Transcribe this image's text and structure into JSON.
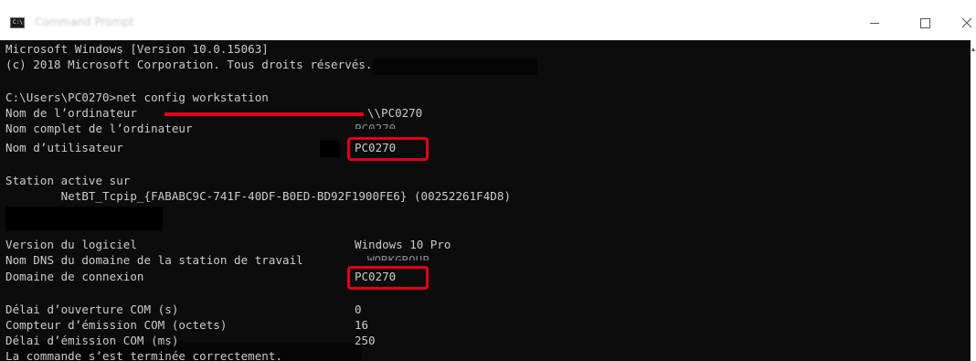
{
  "window": {
    "title": "Command Prompt",
    "minimize_label": "—",
    "maximize_label": "☐",
    "close_label": "✕"
  },
  "console": {
    "header_line1": "Microsoft Windows [Version 10.0.15063]",
    "header_line2": "(c) 2018 Microsoft Corporation. Tous droits réservés.",
    "prompt_line": "C:\\Users\\PC0270>net config workstation",
    "rows": [
      {
        "label": "Nom de l’ordinateur",
        "value": "\\\\PC0270"
      },
      {
        "label": "Nom complet de l’ordinateur",
        "value": "PC0270"
      },
      {
        "label": "Nom d’utilisateur",
        "value": "PC0270"
      }
    ],
    "station_label": "Station active sur",
    "station_value": "        NetBT_Tcpip_{FABABC9C-741F-40DF-B0ED-BD92F1900FE6} (00252261F4D8)",
    "rows2": [
      {
        "label": "Version du logiciel",
        "value": "Windows 10 Pro"
      },
      {
        "label": "Nom DNS du domaine de la station de travail",
        "value": "WORKGROUP"
      },
      {
        "label": "Domaine de connexion",
        "value": "PC0270"
      }
    ],
    "rows3": [
      {
        "label": "Délai d’ouverture COM (s)",
        "value": "0"
      },
      {
        "label": "Compteur d’émission COM (octets)",
        "value": "16"
      },
      {
        "label": "Délai d’émission COM (ms)",
        "value": "250"
      }
    ],
    "final_line": "La commande s’est terminée correctement."
  },
  "colors": {
    "console_bg": "#0c0c0c",
    "console_text": "#cccccc",
    "highlight": "#e3001b"
  },
  "icons": {
    "app": "cmd-icon",
    "minimize": "minimize-icon",
    "maximize": "maximize-icon",
    "close": "close-icon"
  }
}
